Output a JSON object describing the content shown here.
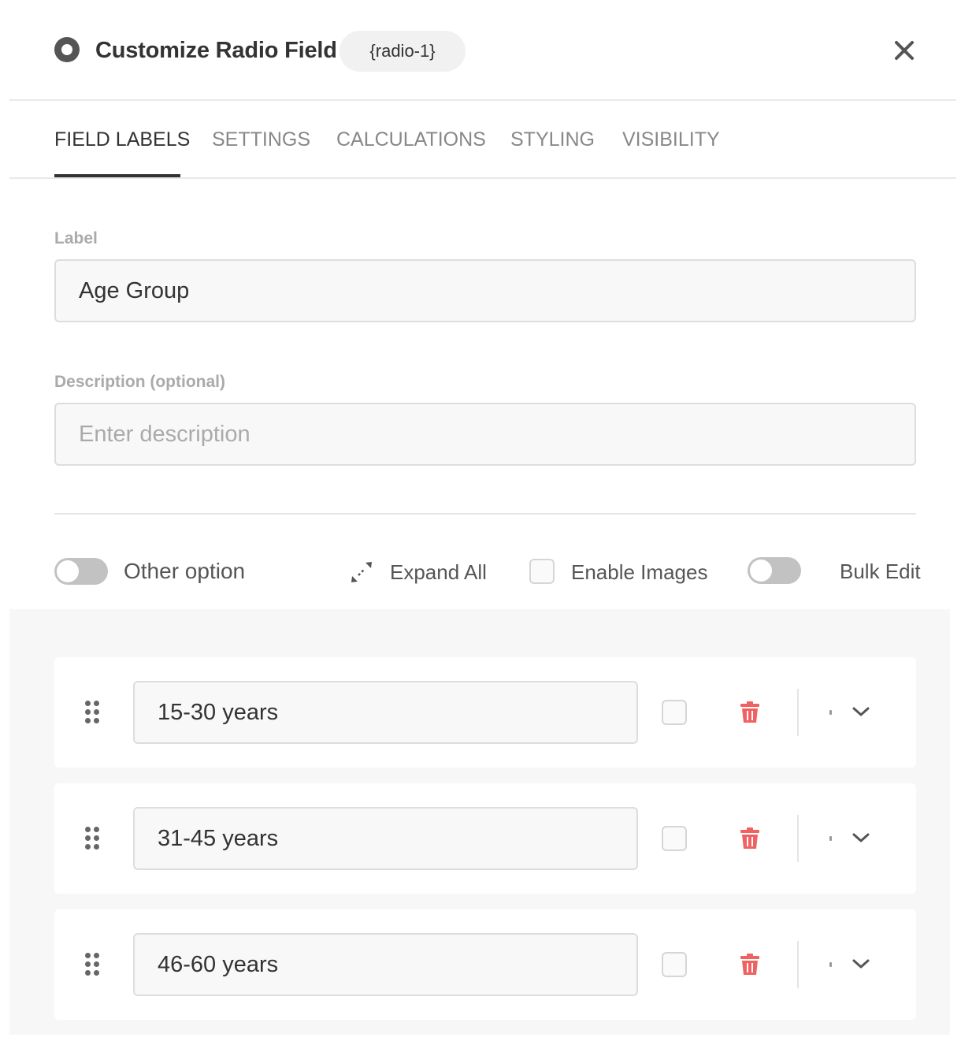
{
  "header": {
    "title": "Customize Radio Field",
    "field_tag": "{radio-1}",
    "icons": {
      "field": "radio-button-icon",
      "close": "close-icon"
    }
  },
  "tabs": [
    {
      "label": "FIELD LABELS",
      "active": true
    },
    {
      "label": "SETTINGS",
      "active": false
    },
    {
      "label": "CALCULATIONS",
      "active": false
    },
    {
      "label": "STYLING",
      "active": false
    },
    {
      "label": "VISIBILITY",
      "active": false
    }
  ],
  "form": {
    "label_title": "Label",
    "label_value": "Age Group",
    "description_title": "Description (optional)",
    "description_value": "",
    "description_placeholder": "Enter description"
  },
  "controls": {
    "other_option": {
      "label": "Other option",
      "on": false
    },
    "expand_all": {
      "label": "Expand All",
      "icon": "expand-arrows-icon"
    },
    "enable_images": {
      "label": "Enable Images",
      "checked": false
    },
    "bulk_edit": {
      "label": "Bulk Edit",
      "on": false
    }
  },
  "options": [
    {
      "value": "15-30 years",
      "default": false
    },
    {
      "value": "31-45 years",
      "default": false
    },
    {
      "value": "46-60 years",
      "default": false
    }
  ],
  "colors": {
    "accent_text": "#333333",
    "muted_text": "#888888",
    "toggle_off": "#c2c2c2",
    "delete": "#f06262",
    "panel_bg": "#f7f7f7"
  }
}
